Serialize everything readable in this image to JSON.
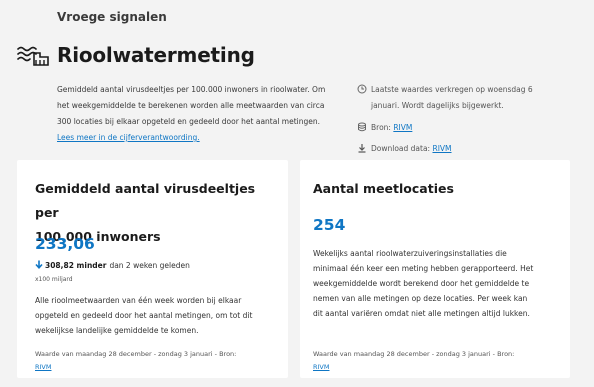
{
  "header": {
    "section_label": "Vroege signalen",
    "title": "Rioolwatermeting",
    "title_icon": "sewage-water-icon"
  },
  "intro": {
    "line1": "Gemiddeld aantal virusdeeltjes per 100.000 inwoners in rioolwater. Om",
    "line2": "het weekgemiddelde te berekenen worden alle meetwaarden van circa",
    "line3": "300 locaties bij elkaar opgeteld en gedeeld door het aantal metingen.",
    "link": "Lees meer in de cijferverantwoording."
  },
  "meta": {
    "updated_line1": "Laatste waardes verkregen op woensdag 6",
    "updated_line2": "januari. Wordt dagelijks bijgewerkt.",
    "source_label": "Bron:",
    "source_link": "RIVM",
    "download_label": "Download data:",
    "download_link": "RIVM"
  },
  "cards": {
    "left": {
      "title_line1": "Gemiddeld aantal virusdeeltjes per",
      "title_line2": "100.000 inwoners",
      "value": "233,06",
      "change_value": "308,82 minder",
      "change_text": "dan 2 weken geleden",
      "unit_note": "x100 miljard",
      "body_line1": "Alle rioolmeetwaarden van één week worden bij elkaar",
      "body_line2": "opgeteld en gedeeld door het aantal metingen, om tot dit",
      "body_line3": "wekelijkse landelijke gemiddelde te komen.",
      "footer": "Waarde van maandag 28 december - zondag 3 januari - Bron:",
      "footer_link": "RIVM"
    },
    "right": {
      "title": "Aantal meetlocaties",
      "value": "254",
      "body_line1": "Wekelijks aantal rioolwaterzuiveringsinstallaties die",
      "body_line2": "minimaal één keer een meting hebben gerapporteerd. Het",
      "body_line3": "weekgemiddelde wordt berekend door het gemiddelde te",
      "body_line4": "nemen van alle metingen op deze locaties. Per week kan",
      "body_line5": "dit aantal variëren omdat niet alle metingen altijd lukken.",
      "footer": "Waarde van maandag 28 december - zondag 3 januari - Bron:",
      "footer_link": "RIVM"
    }
  },
  "colors": {
    "accent": "#0f76c4",
    "background": "#f3f3f3",
    "card": "#ffffff"
  }
}
